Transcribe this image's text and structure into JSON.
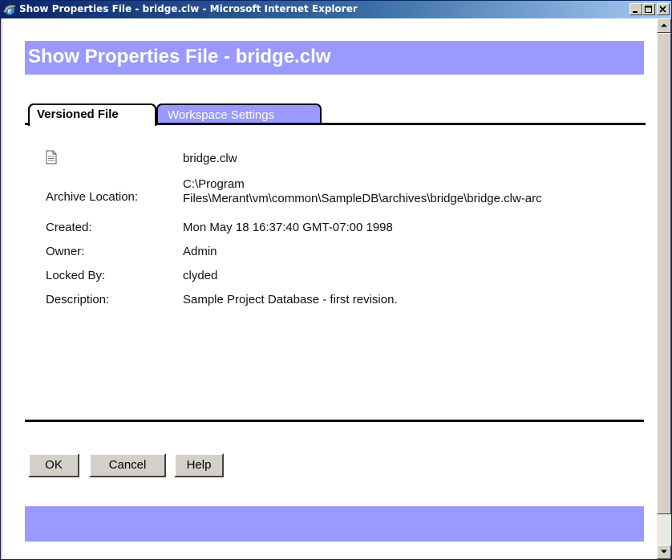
{
  "window": {
    "title": "Show Properties File - bridge.clw - Microsoft Internet Explorer"
  },
  "page": {
    "title": "Show Properties File - bridge.clw"
  },
  "tabs": [
    {
      "label": "Versioned File",
      "active": true
    },
    {
      "label": "Workspace Settings",
      "active": false
    }
  ],
  "properties": {
    "file_name": "bridge.clw",
    "archive_location_label": "Archive Location:",
    "archive_location_line1": "C:\\Program",
    "archive_location_line2": "Files\\Merant\\vm\\common\\SampleDB\\archives\\bridge\\bridge.clw-arc",
    "created_label": "Created:",
    "created_value": "Mon May 18 16:37:40 GMT-07:00 1998",
    "owner_label": "Owner:",
    "owner_value": "Admin",
    "locked_by_label": "Locked By:",
    "locked_by_value": "clyded",
    "description_label": "Description:",
    "description_value": "Sample Project Database - first revision."
  },
  "buttons": {
    "ok": "OK",
    "cancel": "Cancel",
    "help": "Help"
  },
  "colors": {
    "band": "#9999ff",
    "titlebar_start": "#0a246a",
    "titlebar_end": "#a6caf0"
  },
  "icons": {
    "window": "ie-icon",
    "file": "document-icon"
  }
}
